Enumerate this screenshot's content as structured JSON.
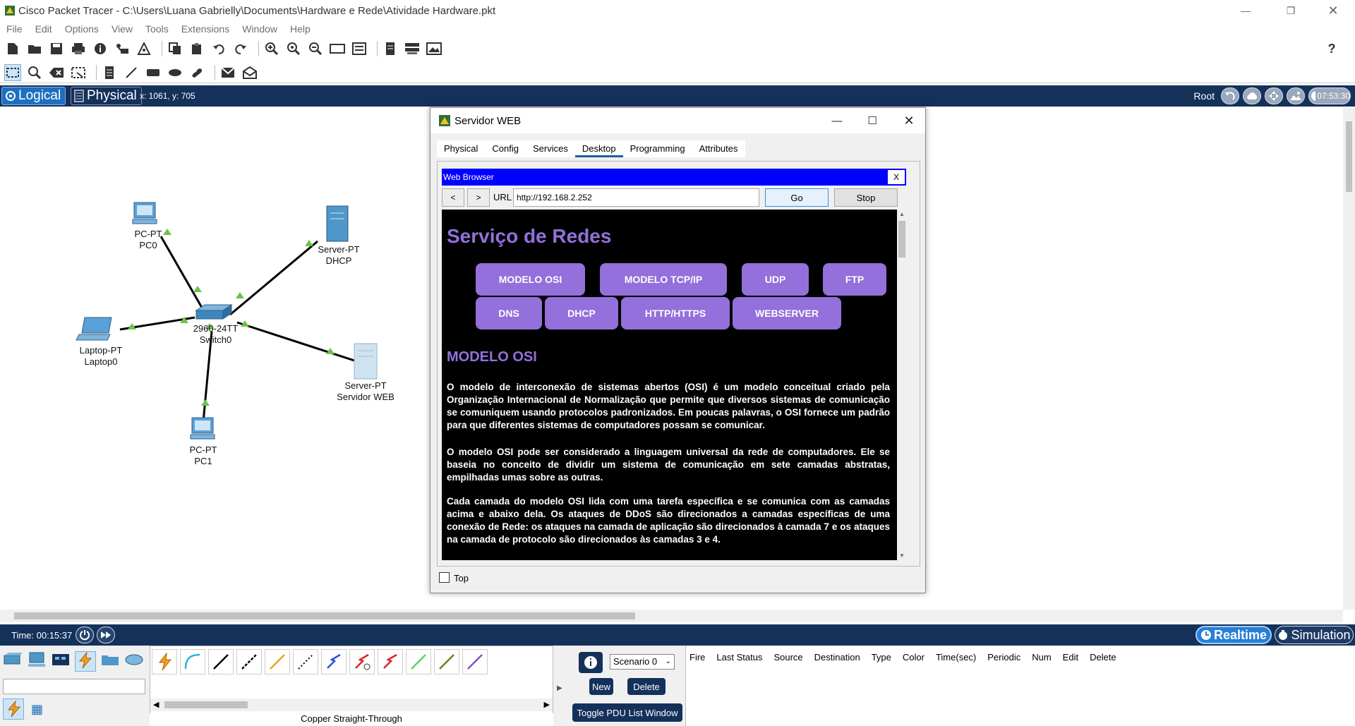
{
  "window": {
    "title": "Cisco Packet Tracer - C:\\Users\\Luana Gabrielly\\Documents\\Hardware e Rede\\Atividade Hardware.pkt"
  },
  "menu": [
    "File",
    "Edit",
    "Options",
    "View",
    "Tools",
    "Extensions",
    "Window",
    "Help"
  ],
  "modebar": {
    "logical": "Logical",
    "physical": "Physical",
    "coords": "x: 1061, y: 705",
    "root": "Root",
    "clock": "07:53:30"
  },
  "devices": [
    {
      "type": "PC-PT",
      "name": "PC0"
    },
    {
      "type": "Server-PT",
      "name": "DHCP"
    },
    {
      "type": "Laptop-PT",
      "name": "Laptop0"
    },
    {
      "type": "2960-24TT",
      "name": "Switch0"
    },
    {
      "type": "Server-PT",
      "name": "Servidor WEB"
    },
    {
      "type": "PC-PT",
      "name": "PC1"
    }
  ],
  "dialog": {
    "title": "Servidor WEB",
    "tabs": [
      "Physical",
      "Config",
      "Services",
      "Desktop",
      "Programming",
      "Attributes"
    ],
    "active_tab": "Desktop",
    "browser": {
      "title": "Web Browser",
      "close": "X",
      "back": "<",
      "forward": ">",
      "url_label": "URL",
      "url": "http://192.168.2.252",
      "go": "Go",
      "stop": "Stop"
    },
    "page": {
      "heading": "Serviço de Redes",
      "nav": [
        "MODELO OSI",
        "MODELO TCP/IP",
        "UDP",
        "FTP",
        "DNS",
        "DHCP",
        "HTTP/HTTPS",
        "WEBSERVER"
      ],
      "section_title": "MODELO OSI",
      "paragraphs": [
        "O modelo de interconexão de sistemas abertos (OSI) é um modelo conceitual criado pela Organização Internacional de Normalização que permite que diversos sistemas de comunicação se comuniquem usando protocolos padronizados. Em poucas palavras, o OSI fornece um padrão para que diferentes sistemas de computadores possam se comunicar.",
        "O modelo OSI pode ser considerado a linguagem universal da rede de computadores. Ele se baseia no conceito de dividir um sistema de comunicação em sete camadas abstratas, empilhadas umas sobre as outras.",
        "Cada camada do modelo OSI lida com uma tarefa específica e se comunica com as camadas acima e abaixo dela. Os ataques de DDoS são direcionados a camadas específicas de uma conexão de Rede: os ataques na camada de aplicação são direcionados à camada 7 e os ataques na camada de protocolo são direcionados às camadas 3 e 4."
      ]
    },
    "top_checkbox": "Top"
  },
  "timebar": {
    "time": "Time: 00:15:37",
    "realtime": "Realtime",
    "simulation": "Simulation"
  },
  "bottom": {
    "connection_label": "Copper Straight-Through",
    "scenario": "Scenario 0",
    "new": "New",
    "delete": "Delete",
    "toggle": "Toggle PDU List Window",
    "pdu_headers": [
      "Fire",
      "Last Status",
      "Source",
      "Destination",
      "Type",
      "Color",
      "Time(sec)",
      "Periodic",
      "Num",
      "Edit",
      "Delete"
    ]
  },
  "colors": {
    "navy": "#14315a",
    "purple": "#9370db",
    "browser_blue": "#0000ff",
    "link_green": "#6cc24a"
  }
}
